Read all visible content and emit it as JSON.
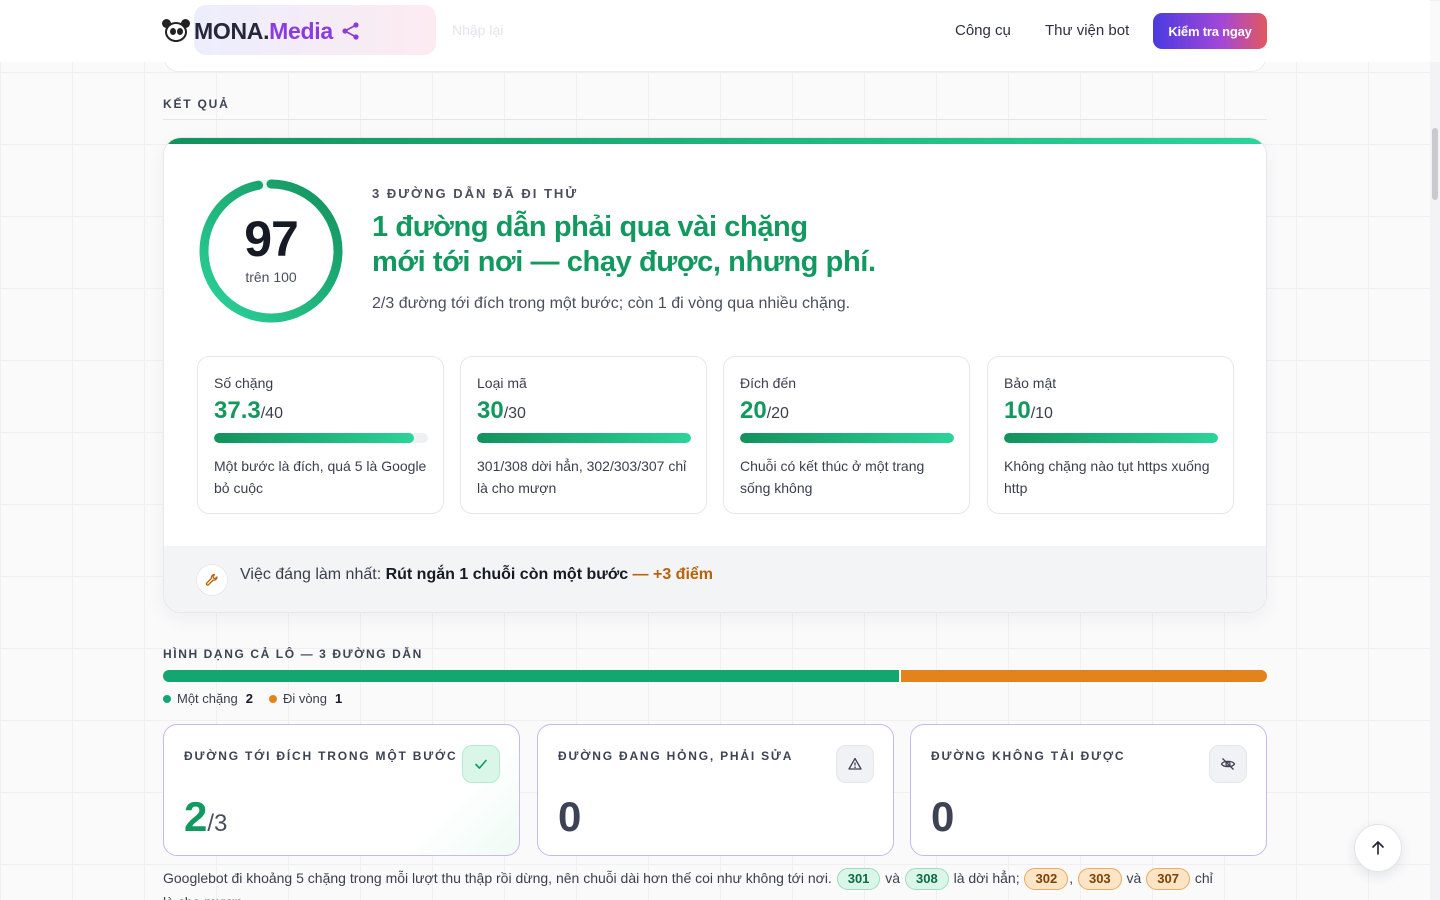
{
  "header": {
    "logo_mona": "MONA.",
    "logo_media": "Media",
    "ghost_input_text": "Nhập lại",
    "nav": [
      {
        "label": "Công cụ"
      },
      {
        "label": "Thư viện bot"
      }
    ],
    "cta_label": "Kiểm tra ngay",
    "accent_colors": [
      "#3d4fd6",
      "#7b3ff0",
      "#ee5f5f"
    ]
  },
  "result": {
    "section_label": "KẾT QUẢ",
    "score": "97",
    "score_value": 97,
    "score_max": 100,
    "score_sub": "trên 100",
    "tried_label": "3 ĐƯỜNG DẪN ĐÃ ĐI THỬ",
    "headline_line1": "1 đường dẫn phải qua vài chặng",
    "headline_line2": "mới tới nơi — chạy được, nhưng phí.",
    "summary": "2/3 đường tới đích trong một bước; còn 1 đi vòng qua nhiều chặng.",
    "metrics": [
      {
        "label": "Số chặng",
        "score": "37.3",
        "max": "/40",
        "fraction": 0.9325,
        "desc": "Một bước là đích, quá 5 là Google bỏ cuộc"
      },
      {
        "label": "Loại mã",
        "score": "30",
        "max": "/30",
        "fraction": 1.0,
        "desc": "301/308 dời hẳn, 302/303/307 chỉ là cho mượn"
      },
      {
        "label": "Đích đến",
        "score": "20",
        "max": "/20",
        "fraction": 1.0,
        "desc": "Chuỗi có kết thúc ở một trang sống không"
      },
      {
        "label": "Bảo mật",
        "score": "10",
        "max": "/10",
        "fraction": 1.0,
        "desc": "Không chặng nào tụt https xuống http"
      }
    ],
    "tip_prefix": "Việc đáng làm nhất: ",
    "tip_action": "Rút ngắn 1 chuỗi còn một bước",
    "tip_gain": " — +3 điểm",
    "accent_green": "#12995f"
  },
  "shape": {
    "section_label": "HÌNH DẠNG CẢ LÔ — 3 ĐƯỜNG DẪN",
    "segments": [
      {
        "label": "Một chặng",
        "count": "2",
        "value": 2,
        "color": "#13a670"
      },
      {
        "label": "Đi vòng",
        "count": "1",
        "value": 1,
        "color": "#e2841b"
      }
    ],
    "cards": [
      {
        "label": "ĐƯỜNG TỚI ĐÍCH TRONG MỘT BƯỚC",
        "value": "2",
        "denominator": "/3",
        "icon": "check-icon"
      },
      {
        "label": "ĐƯỜNG ĐANG HỎNG, PHẢI SỬA",
        "value": "0",
        "denominator": "",
        "icon": "warning-icon"
      },
      {
        "label": "ĐƯỜNG KHÔNG TẢI ĐƯỢC",
        "value": "0",
        "denominator": "",
        "icon": "eye-off-icon"
      }
    ],
    "footnote": {
      "text1": "Googlebot đi khoảng 5 chặng trong mỗi lượt thu thập rồi dừng, nên chuỗi dài hơn thế coi như không tới nơi. ",
      "code1": "301",
      "and1": " và ",
      "code2": "308",
      "text2": " là dời hẳn; ",
      "code3": "302",
      "comma": ", ",
      "code4": "303",
      "and2": " và ",
      "code5": "307",
      "text3": " chỉ là cho mượn."
    }
  }
}
